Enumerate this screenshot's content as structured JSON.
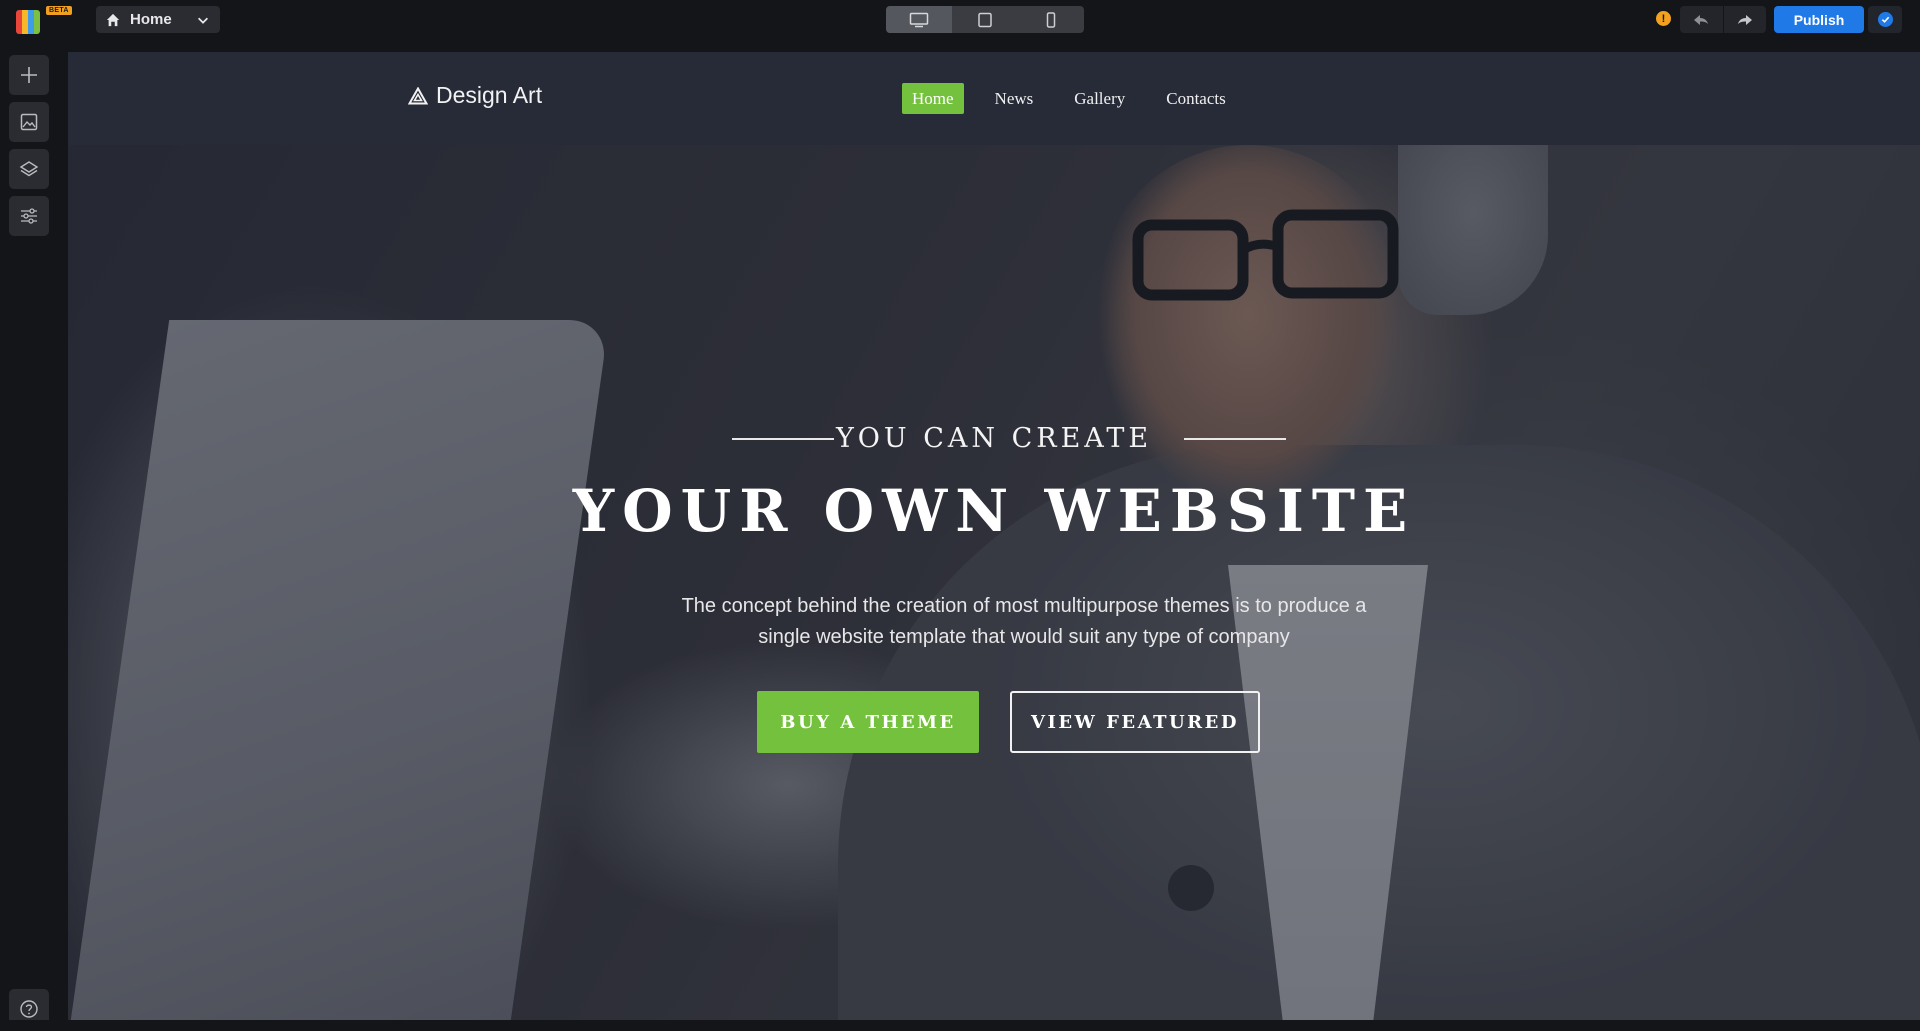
{
  "toolbar": {
    "beta_badge": "BETA",
    "page_select": {
      "label": "Home"
    },
    "devices": [
      "desktop",
      "tablet",
      "mobile"
    ],
    "active_device": "desktop",
    "warning_glyph": "!",
    "publish_label": "Publish"
  },
  "sidebar": {
    "items": [
      {
        "icon": "plus-icon"
      },
      {
        "icon": "image-icon"
      },
      {
        "icon": "layers-icon"
      },
      {
        "icon": "sliders-icon"
      }
    ],
    "help_icon": "help-icon"
  },
  "site": {
    "brand": "Design Art",
    "nav": [
      {
        "label": "Home",
        "active": true
      },
      {
        "label": "News",
        "active": false
      },
      {
        "label": "Gallery",
        "active": false
      },
      {
        "label": "Contacts",
        "active": false
      }
    ],
    "hero": {
      "eyebrow": "YOU CAN CREATE",
      "headline": "YOUR OWN WEBSITE",
      "subtext_line1": "The concept behind the creation of most multipurpose themes is to produce a",
      "subtext_line2": "single website template that would suit any type of company",
      "primary_button": "BUY A THEME",
      "secondary_button": "VIEW FEATURED"
    }
  },
  "colors": {
    "accent_green": "#74c13d",
    "publish_blue": "#1f7ae8",
    "warning_orange": "#f3a11e",
    "nav_bg": "#262b37"
  }
}
